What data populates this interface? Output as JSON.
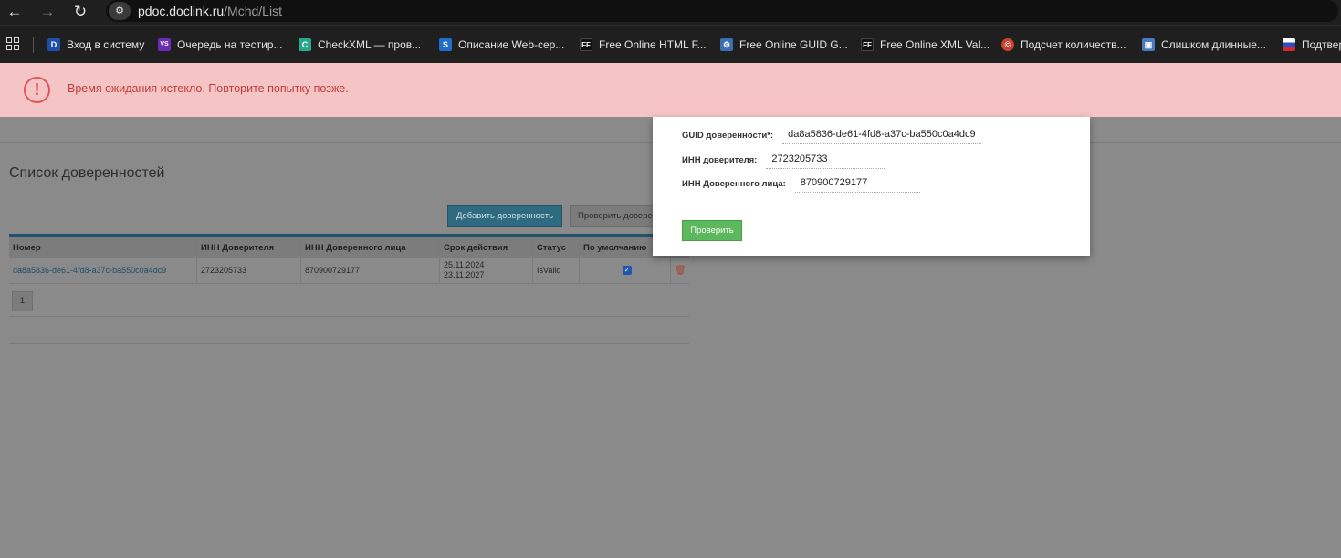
{
  "browser": {
    "url_host": "pdoc.doclink.ru",
    "url_path": "/Mchd/List",
    "bookmarks": [
      {
        "label": "Вход в систему",
        "icon": "D",
        "color": "#1e4fa8"
      },
      {
        "label": "Очередь на тестир...",
        "icon": "VS",
        "color": "#6a2bb5"
      },
      {
        "label": "CheckXML — пров...",
        "icon": "C",
        "color": "#27a88a"
      },
      {
        "label": "Описание Web-сер...",
        "icon": "S",
        "color": "#1f6ec9"
      },
      {
        "label": "Free Online HTML F...",
        "icon": "FF",
        "color": "#111111"
      },
      {
        "label": "Free Online GUID G...",
        "icon": "⚙",
        "color": "#3b6fb0"
      },
      {
        "label": "Free Online XML Val...",
        "icon": "FF",
        "color": "#111111"
      },
      {
        "label": "Подсчет количеств...",
        "icon": "©",
        "color": "#c9412f"
      },
      {
        "label": "Слишком длинные...",
        "icon": "▣",
        "color": "#4c7ab8"
      },
      {
        "label": "Подтвер",
        "icon": "RU",
        "color": "#d6252c"
      }
    ]
  },
  "error": {
    "message": "Время ожидания истекло. Повторите попытку позже."
  },
  "page": {
    "title": "Список доверенностей",
    "add_button": "Добавить доверенность",
    "check_button": "Проверить доверенность",
    "columns": [
      "Номер",
      "ИНН Доверителя",
      "ИНН Доверенного лица",
      "Срок действия",
      "Статус",
      "По умолчанию"
    ],
    "rows": [
      {
        "number": "da8a5836-de61-4fd8-a37c-ba550c0a4dc9",
        "inn_principal": "2723205733",
        "inn_agent": "870900729177",
        "valid_from": "25.11.2024",
        "valid_to": "23.11.2027",
        "status": "IsValid",
        "default": true
      }
    ],
    "pager": [
      "1"
    ]
  },
  "modal": {
    "guid_label": "GUID доверенности*:",
    "guid_value": "da8a5836-de61-4fd8-a37c-ba550c0a4dc9",
    "inn_principal_label": "ИНН доверителя:",
    "inn_principal_value": "2723205733",
    "inn_agent_label": "ИНН Доверенного лица:",
    "inn_agent_value": "870900729177",
    "verify_button": "Проверить"
  },
  "colors": {
    "error_bg": "#f5c4c4",
    "error_text": "#c43a3a",
    "success_button": "#5cb85c",
    "table_header_bar": "#23536a"
  }
}
